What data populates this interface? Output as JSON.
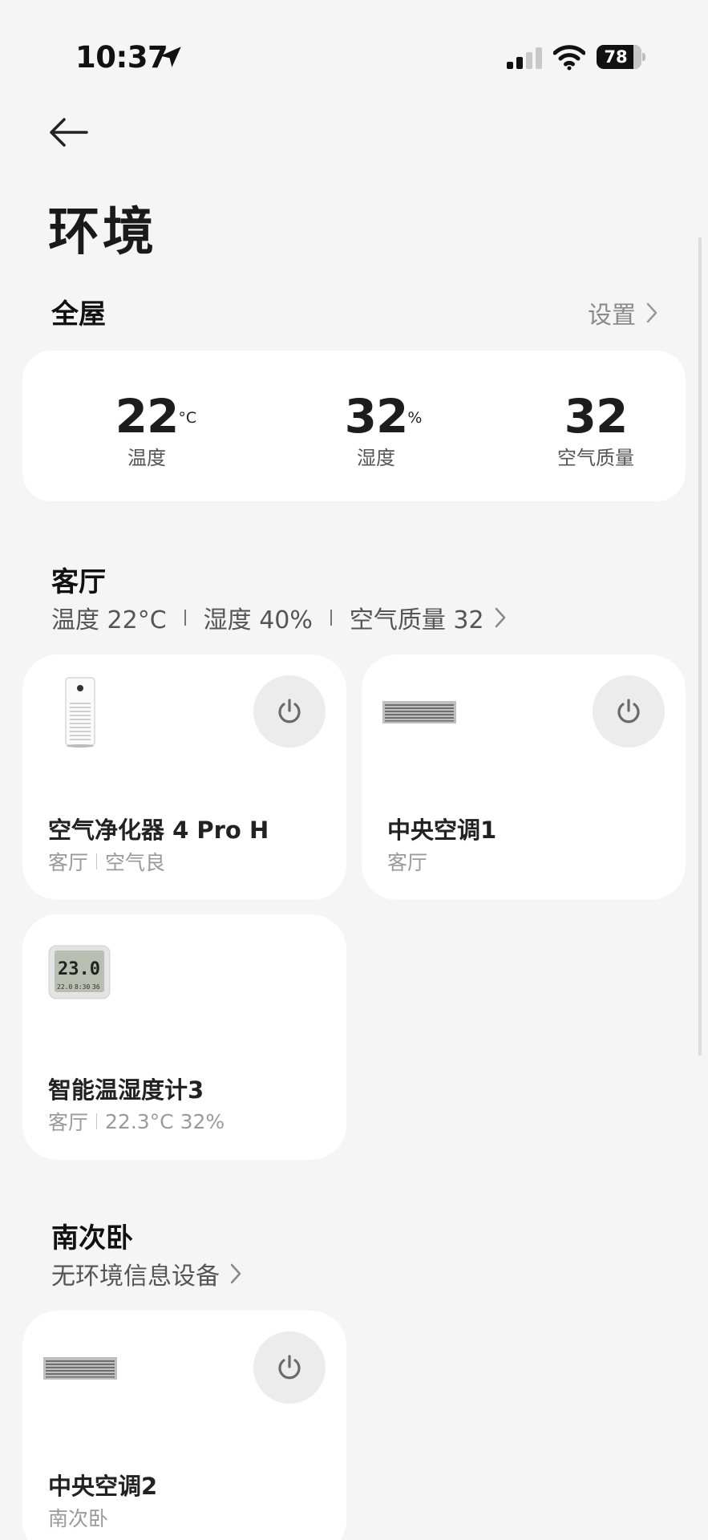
{
  "status_bar": {
    "time": "10:37",
    "battery": "78"
  },
  "header": {
    "title": "环境"
  },
  "whole_house": {
    "title": "全屋",
    "settings_label": "设置",
    "temperature": {
      "value": "22",
      "unit": "°C",
      "label": "温度"
    },
    "humidity": {
      "value": "32",
      "unit": "%",
      "label": "湿度"
    },
    "air_quality": {
      "value": "32",
      "label": "空气质量"
    }
  },
  "living_room": {
    "title": "客厅",
    "info": {
      "temperature": "温度 22°C",
      "humidity": "湿度 40%",
      "air_quality": "空气质量 32"
    },
    "devices": [
      {
        "name": "空气净化器 4 Pro H",
        "room": "客厅",
        "status": "空气良"
      },
      {
        "name": "中央空调1",
        "room": "客厅"
      },
      {
        "name": "智能温湿度计3",
        "room": "客厅",
        "status": "22.3°C 32%",
        "display": {
          "main": "23.0",
          "sub1": "22.0",
          "sub2": "8:30",
          "sub3": "36"
        }
      }
    ]
  },
  "south_bedroom": {
    "title": "南次卧",
    "info": "无环境信息设备",
    "devices": [
      {
        "name": "中央空调2",
        "room": "南次卧"
      }
    ]
  }
}
